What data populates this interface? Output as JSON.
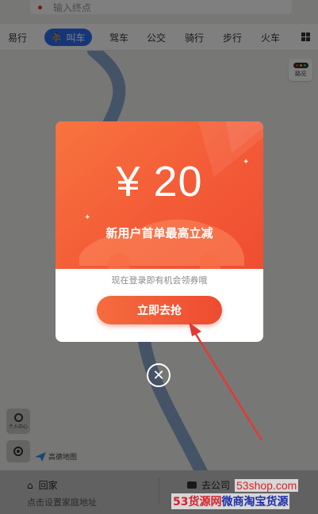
{
  "search": {
    "placeholder_text": "输入终点"
  },
  "tabs": [
    {
      "label": "易行"
    },
    {
      "label": "叫车",
      "active": true
    },
    {
      "label": "驾车"
    },
    {
      "label": "公交"
    },
    {
      "label": "骑行"
    },
    {
      "label": "步行"
    },
    {
      "label": "火车"
    }
  ],
  "traffic": {
    "label": "路况"
  },
  "promo": {
    "amount": "¥ 20",
    "subtitle": "新用户首单最高立减",
    "hint": "现在登录即有机会领券哦",
    "button_label": "立即去抢",
    "close_glyph": "✕"
  },
  "map_controls": {
    "personal_center_label": "个人中心",
    "brand_label": "高德地图"
  },
  "bottom": {
    "home_title": "回家",
    "home_subtitle": "点击设置家庭地址",
    "company_title": "去公司"
  },
  "watermark": {
    "site": "53shop.com",
    "name_part1": "53货源网",
    "name_part2": "微商淘宝货源"
  },
  "colors": {
    "accent_blue": "#2f6df0",
    "promo_orange": "#f35b37",
    "route_blue": "#8aa6cf"
  }
}
